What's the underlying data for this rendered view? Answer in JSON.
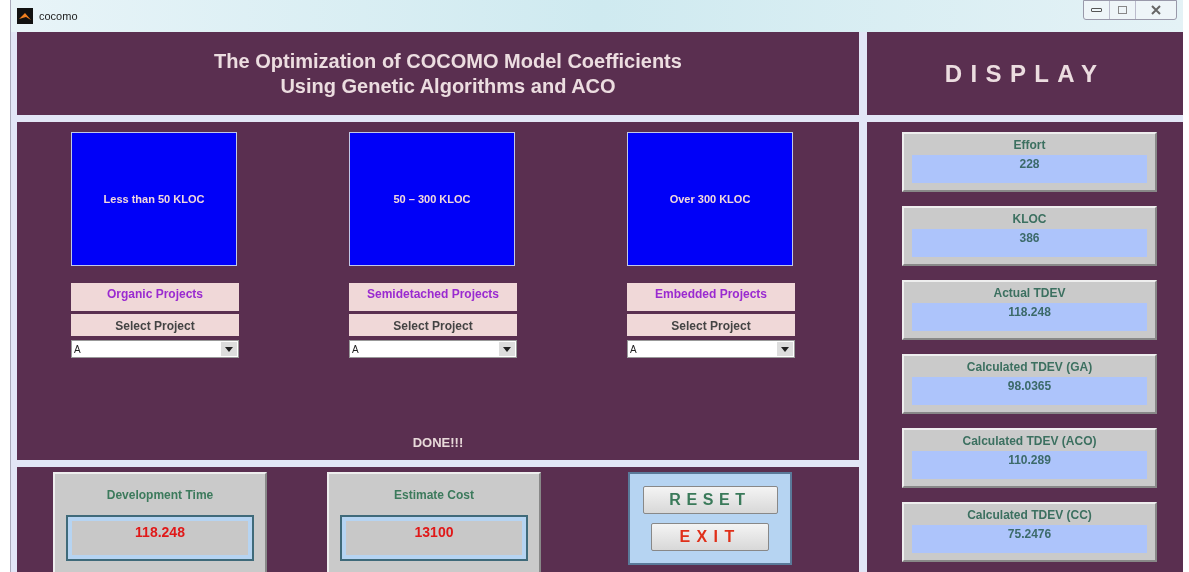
{
  "window": {
    "title": "cocomo"
  },
  "header": {
    "lines": [
      "The Optimization of COCOMO Model Coefficients",
      "Using Genetic Algorithms and ACO"
    ]
  },
  "categories": [
    {
      "tile": "Less than 50 KLOC",
      "label": "Organic Projects",
      "prompt": "Select Project",
      "value": "A"
    },
    {
      "tile": "50 – 300 KLOC",
      "label": "Semidetached Projects",
      "prompt": "Select Project",
      "value": "A"
    },
    {
      "tile": "Over 300 KLOC",
      "label": "Embedded Projects",
      "prompt": "Select Project",
      "value": "A"
    }
  ],
  "status": "DONE!!!",
  "outputs": [
    {
      "label": "Development Time",
      "value": "118.248"
    },
    {
      "label": "Estimate Cost",
      "value": "13100"
    }
  ],
  "buttons": [
    {
      "label": "RESET",
      "kind": "reset"
    },
    {
      "label": "EXIT",
      "kind": "exit"
    }
  ],
  "display": {
    "title": "DISPLAY",
    "items": [
      {
        "label": "Effort",
        "value": "228"
      },
      {
        "label": "KLOC",
        "value": "386"
      },
      {
        "label": "Actual TDEV",
        "value": "118.248"
      },
      {
        "label": "Calculated TDEV (GA)",
        "value": "98.0365"
      },
      {
        "label": "Calculated TDEV (ACO)",
        "value": "110.289"
      },
      {
        "label": "Calculated TDEV (CC)",
        "value": "75.2476"
      }
    ]
  }
}
